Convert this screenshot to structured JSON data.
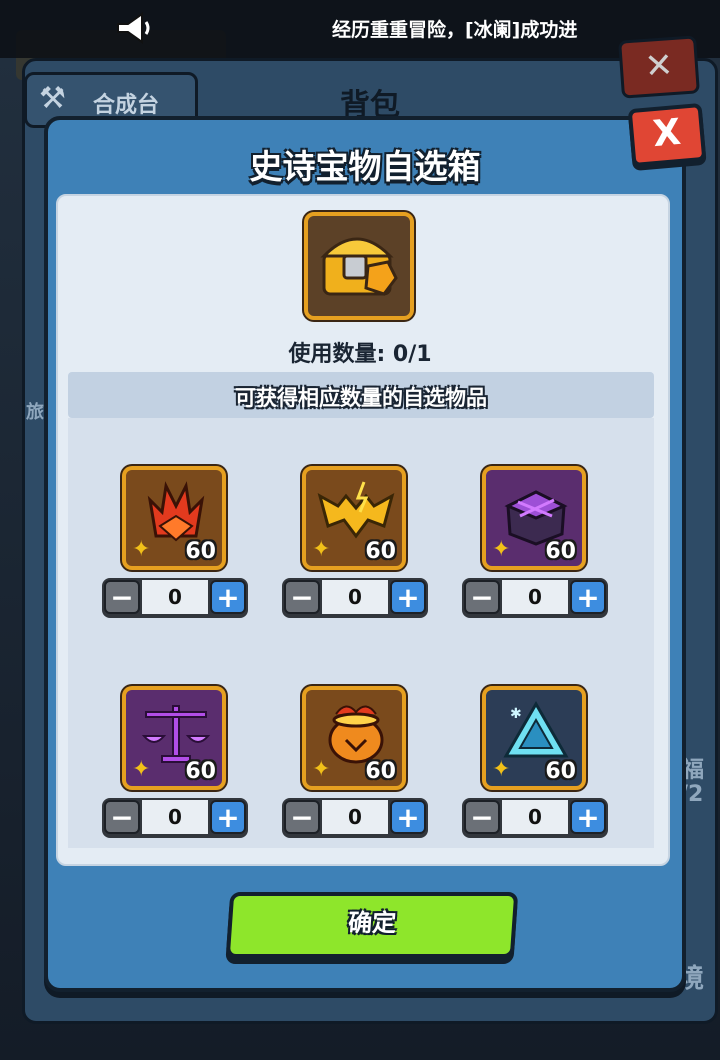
{
  "announcement": {
    "text": "经历重重冒险，[冰阑]成功进"
  },
  "background": {
    "tab_label": "合成台",
    "title": "背包",
    "side_left": "旅",
    "side_right_top": "福",
    "side_right_bottom": "/2",
    "side_bottom_right": "境"
  },
  "modal": {
    "title": "史诗宝物自选箱",
    "close_label": "X",
    "use_count": "使用数量: 0/1",
    "subtitle": "可获得相应数量的自选物品",
    "confirm_label": "确定"
  },
  "items": [
    {
      "icon": "flame-crown-icon",
      "count": "60",
      "qty": "0"
    },
    {
      "icon": "golden-bat-icon",
      "count": "60",
      "qty": "0"
    },
    {
      "icon": "purple-dark-box-icon",
      "count": "60",
      "qty": "0"
    },
    {
      "icon": "purple-scales-icon",
      "count": "60",
      "qty": "0"
    },
    {
      "icon": "flaming-cauldron-icon",
      "count": "60",
      "qty": "0"
    },
    {
      "icon": "ice-prism-pendant-icon",
      "count": "60",
      "qty": "0"
    }
  ],
  "stepper": {
    "minus": "−",
    "plus": "+"
  },
  "colors": {
    "modal_blue": "#3e81b7",
    "close_red": "#e04634",
    "confirm_green": "#8ee62b",
    "card_gold_border": "#e6a020",
    "plus_blue": "#3d8de0"
  }
}
